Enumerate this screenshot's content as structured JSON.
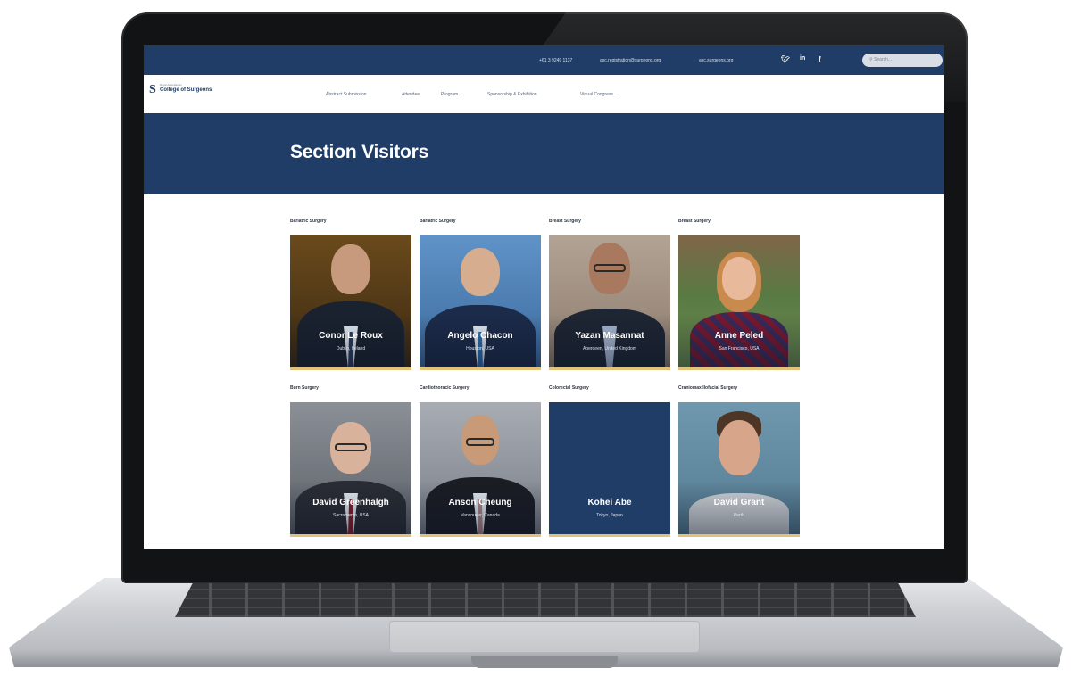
{
  "topbar": {
    "phone": "+61 3 9249 1137",
    "email": "asc.registration@surgeons.org",
    "website": "asc.surgeons.org",
    "social": [
      "twitter-icon",
      "linkedin-icon",
      "facebook-icon"
    ],
    "search_placeholder": "Search..."
  },
  "logo": {
    "small_text": "Royal Australasian",
    "name": "College of Surgeons"
  },
  "nav": {
    "items": [
      "Abstract Submission",
      "Attendee",
      "Program ⌄",
      "Sponsorship & Exhibition",
      "Virtual Congress ⌄"
    ]
  },
  "hero": {
    "title": "Section Visitors"
  },
  "visitors": [
    {
      "specialty": "Bariatric Surgery",
      "name": "Conor Le Roux",
      "location": "Dublin, Ireland"
    },
    {
      "specialty": "Bariatric Surgery",
      "name": "Angelo Chacon",
      "location": "Houston, USA"
    },
    {
      "specialty": "Breast Surgery",
      "name": "Yazan Masannat",
      "location": "Aberdeen, United Kingdom"
    },
    {
      "specialty": "Breast Surgery",
      "name": "Anne Peled",
      "location": "San Francisco, USA"
    },
    {
      "specialty": "Burn Surgery",
      "name": "David Greenhalgh",
      "location": "Sacramento, USA"
    },
    {
      "specialty": "Cardiothoracic Surgery",
      "name": "Anson Cheung",
      "location": "Vancouver, Canada"
    },
    {
      "specialty": "Colorectal Surgery",
      "name": "Kohei Abe",
      "location": "Tokyo, Japan"
    },
    {
      "specialty": "Craniomaxillofacial Surgery",
      "name": "David Grant",
      "location": "Perth"
    }
  ],
  "colors": {
    "navy": "#1f3d67",
    "gold_accent": "#e2c27a"
  }
}
